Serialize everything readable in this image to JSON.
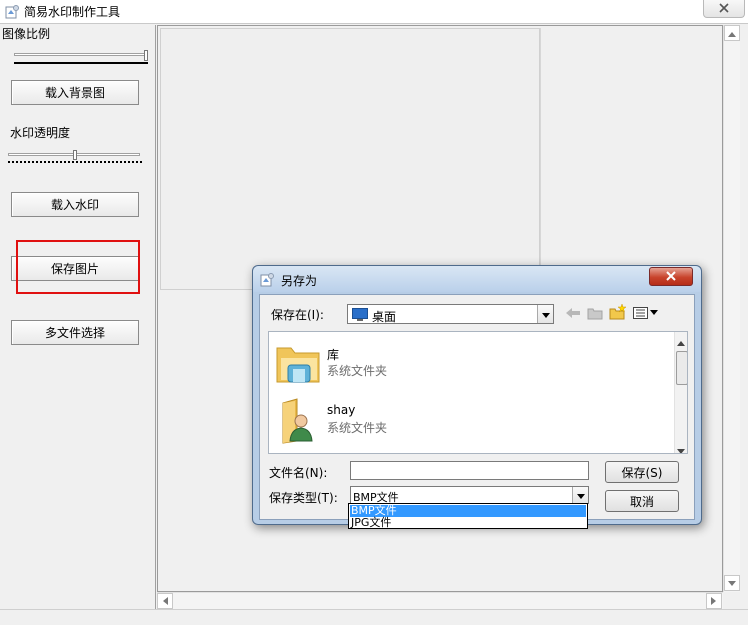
{
  "window": {
    "title": "简易水印制作工具"
  },
  "left_panel": {
    "image_ratio_label": "图像比例",
    "image_ratio_value": 1.0,
    "load_background_button": "载入背景图",
    "watermark_opacity_label": "水印透明度",
    "watermark_opacity_value": 0.5,
    "load_watermark_button": "载入水印",
    "save_image_button": "保存图片",
    "multi_file_button": "多文件选择"
  },
  "dialog": {
    "title": "另存为",
    "save_in_label": "保存在(I):",
    "save_in_value": "桌面",
    "items": [
      {
        "name": "库",
        "type": "系统文件夹",
        "icon": "library-folder-icon"
      },
      {
        "name": "shay",
        "type": "系统文件夹",
        "icon": "user-folder-icon"
      }
    ],
    "filename_label": "文件名(N):",
    "filename_value": "",
    "filetype_label": "保存类型(T):",
    "filetype_value": "BMP文件",
    "filetype_options": [
      "BMP文件",
      "JPG文件"
    ],
    "save_button": "保存(S)",
    "cancel_button": "取消"
  },
  "colors": {
    "highlight_border": "#e01010",
    "selected_option_bg": "#3399ff",
    "dialog_frame": "#b7cde6"
  }
}
